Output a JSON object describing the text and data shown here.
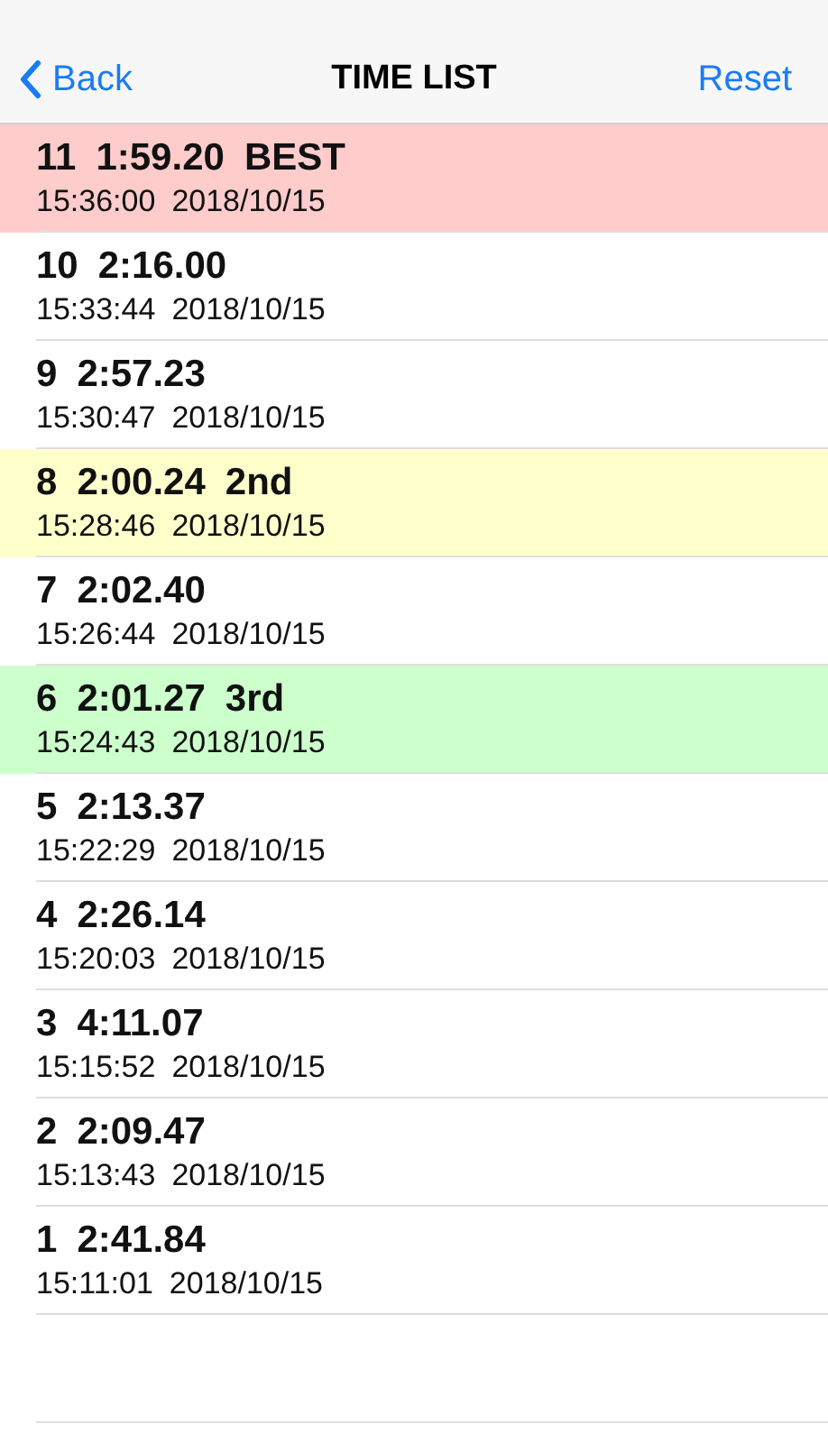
{
  "nav_bar": {
    "back": "Back",
    "title": "TIME LIST",
    "action": "Reset"
  },
  "laps": [
    {
      "number": "11",
      "time": "1:59.20",
      "rank": "BEST",
      "color": "#ffcccc",
      "clock": "15:36:00",
      "date": "2018/10/15"
    },
    {
      "number": "10",
      "time": "2:16.00",
      "clock": "15:33:44",
      "date": "2018/10/15"
    },
    {
      "number": "9",
      "time": "2:57.23",
      "clock": "15:30:47",
      "date": "2018/10/15"
    },
    {
      "number": "8",
      "time": "2:00.24",
      "rank": "2nd",
      "color": "#ffffcc",
      "clock": "15:28:46",
      "date": "2018/10/15"
    },
    {
      "number": "7",
      "time": "2:02.40",
      "clock": "15:26:44",
      "date": "2018/10/15"
    },
    {
      "number": "6",
      "time": "2:01.27",
      "rank": "3rd",
      "color": "#ccffcc",
      "clock": "15:24:43",
      "date": "2018/10/15"
    },
    {
      "number": "5",
      "time": "2:13.37",
      "clock": "15:22:29",
      "date": "2018/10/15"
    },
    {
      "number": "4",
      "time": "2:26.14",
      "clock": "15:20:03",
      "date": "2018/10/15"
    },
    {
      "number": "3",
      "time": "4:11.07",
      "clock": "15:15:52",
      "date": "2018/10/15"
    },
    {
      "number": "2",
      "time": "2:09.47",
      "clock": "15:13:43",
      "date": "2018/10/15"
    },
    {
      "number": "1",
      "time": "2:41.84",
      "clock": "15:11:01",
      "date": "2018/10/15"
    }
  ]
}
